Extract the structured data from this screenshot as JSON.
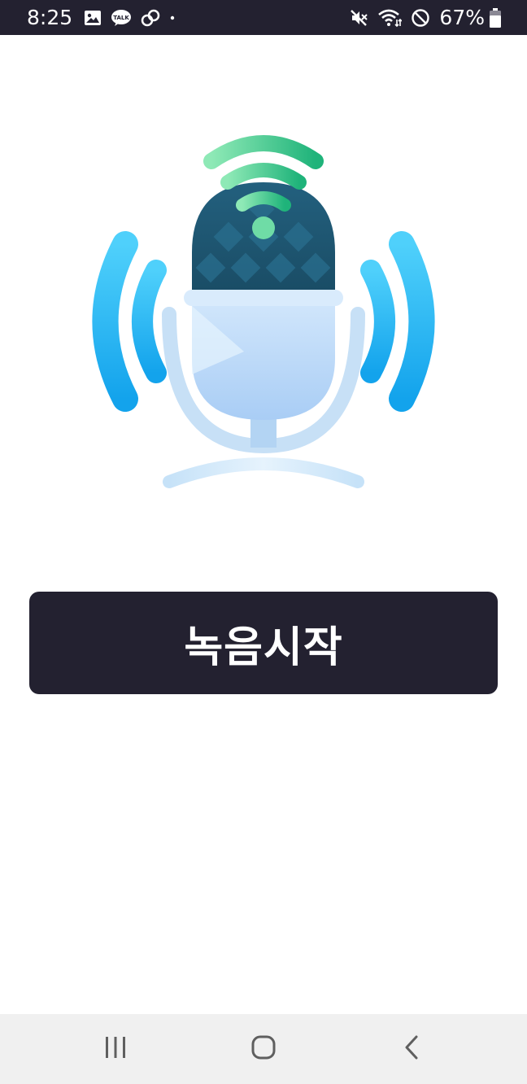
{
  "status_bar": {
    "time": "8:25",
    "battery_percent": "67%",
    "left_icons": [
      "gallery-icon",
      "kakaotalk-icon",
      "link-icon",
      "dot-icon"
    ],
    "right_icons": [
      "mute-icon",
      "wifi-icon",
      "do-not-disturb-icon",
      "battery-icon"
    ],
    "talk_badge": "TALK"
  },
  "hero": {
    "icon": "microphone-signal-icon",
    "colors": {
      "wave_blue": "#2fb7f2",
      "signal_green": "#4fd49a",
      "mic_head": "#1f5a76",
      "mic_body": "#b9d8f7"
    }
  },
  "main": {
    "record_button_label": "녹음시작"
  },
  "nav_bar": {
    "recent_apps": "recent-apps-icon",
    "home": "home-icon",
    "back": "back-icon"
  }
}
